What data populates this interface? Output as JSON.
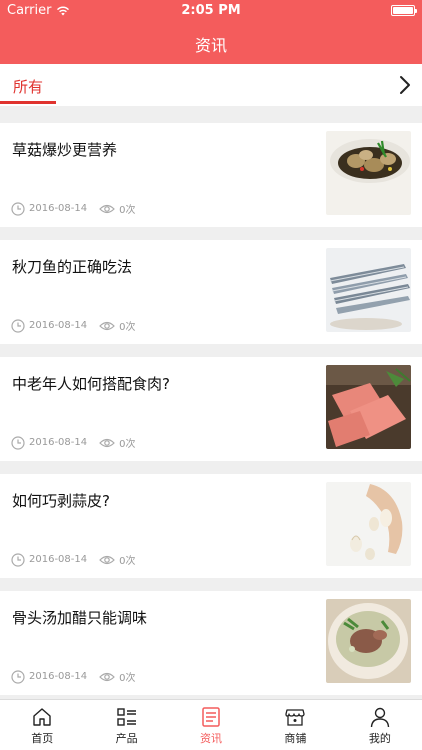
{
  "status_bar": {
    "carrier": "Carrier",
    "time": "2:05 PM"
  },
  "header": {
    "title": "资讯"
  },
  "tabs": {
    "active_label": "所有"
  },
  "articles": [
    {
      "title": "草菇爆炒更营养",
      "date": "2016-08-14",
      "views": "0次"
    },
    {
      "title": "秋刀鱼的正确吃法",
      "date": "2016-08-14",
      "views": "0次"
    },
    {
      "title": "中老年人如何搭配食肉?",
      "date": "2016-08-14",
      "views": "0次"
    },
    {
      "title": "如何巧剥蒜皮?",
      "date": "2016-08-14",
      "views": "0次"
    },
    {
      "title": "骨头汤加醋只能调味",
      "date": "2016-08-14",
      "views": "0次"
    }
  ],
  "bottom_nav": [
    {
      "label": "首页",
      "icon": "home-icon"
    },
    {
      "label": "产品",
      "icon": "list-icon"
    },
    {
      "label": "资讯",
      "icon": "news-icon"
    },
    {
      "label": "商铺",
      "icon": "shop-icon"
    },
    {
      "label": "我的",
      "icon": "user-icon"
    }
  ],
  "colors": {
    "brand": "#f45c5c",
    "active_tab": "#e0332f"
  }
}
